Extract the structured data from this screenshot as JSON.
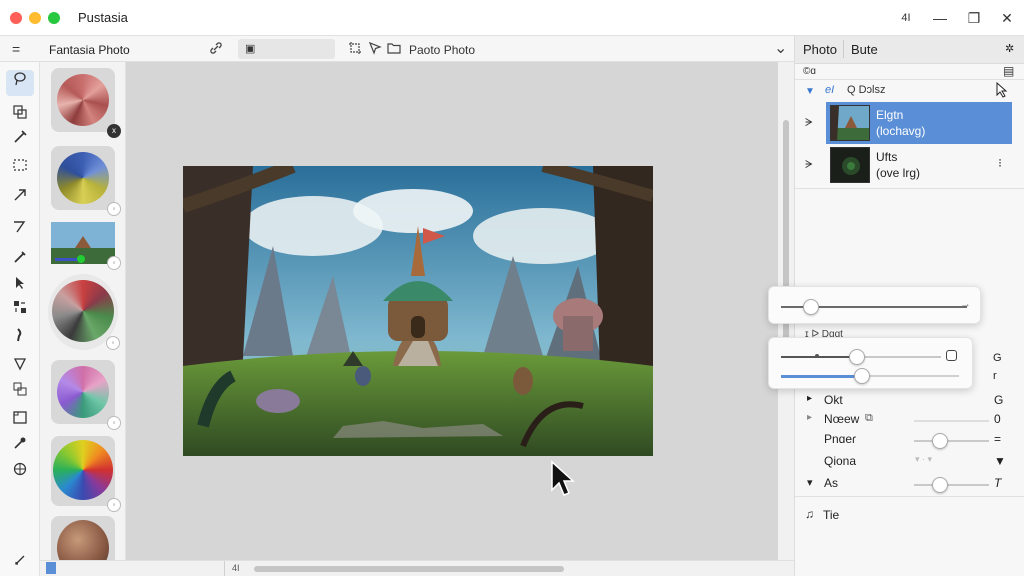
{
  "window": {
    "title": "Pustasia",
    "controls": {
      "extra": "4I",
      "minimize": "—",
      "restore": "❐",
      "close": "✕"
    }
  },
  "toolbar": {
    "menu_icon": "=",
    "title": "Fantasia Photo",
    "field_icon": "▣",
    "doc_title": "Paoto Photo",
    "chevron": "⌄"
  },
  "tools": [
    "lasso-icon",
    "layers-icon",
    "brush-icon",
    "select-icon",
    "arrow-icon",
    "pen-icon",
    "eyedropper-icon",
    "pointer-icon",
    "move-icon",
    "smudge-icon",
    "shield-icon",
    "copy-icon",
    "frame-icon",
    "dropper-icon",
    "globe-icon",
    "expand-icon"
  ],
  "swatches": [
    {
      "name": "swatch-red",
      "badge": "x"
    },
    {
      "name": "swatch-yellow-blue",
      "badge": "◦"
    },
    {
      "name": "swatch-scene",
      "badge": "◦"
    },
    {
      "name": "swatch-multicolor",
      "badge": "◦"
    },
    {
      "name": "swatch-pastel",
      "badge": "◦"
    },
    {
      "name": "swatch-rainbow",
      "badge": "◦"
    },
    {
      "name": "swatch-planet",
      "badge": ""
    }
  ],
  "status": {
    "page": "4I"
  },
  "right_panel": {
    "tabs": [
      "Photo",
      "Bute"
    ],
    "header_left": "©ɑ",
    "group": {
      "label": "eI",
      "name": "Q Dɔlsz"
    },
    "layers": [
      {
        "line1": "Elgtn",
        "line2": "(lochavg)",
        "selected": true
      },
      {
        "line1": "Ufts",
        "line2": "(ove lrg)",
        "selected": false
      }
    ],
    "section_label": "ɪ ᐅ Dɑɑt",
    "props": [
      {
        "label": "Okt",
        "value": "G",
        "arrow": "▸"
      },
      {
        "label": "Nœew",
        "value": "0",
        "arrow": "▸"
      },
      {
        "label": "Pnɑeɾ",
        "value": "=",
        "arrow": ""
      },
      {
        "label": "Qiona",
        "value": "▼",
        "arrow": ""
      },
      {
        "label": "As",
        "value": "T",
        "arrow": "▾"
      }
    ],
    "footer": "Tie",
    "side_values": [
      "G",
      "r"
    ]
  },
  "sliders": {
    "popup1": 0.16,
    "popup2a": 0.42,
    "popup2b": 0.45,
    "prop_pnaer": 0.35,
    "prop_as": 0.35,
    "popup1_end": "→"
  }
}
